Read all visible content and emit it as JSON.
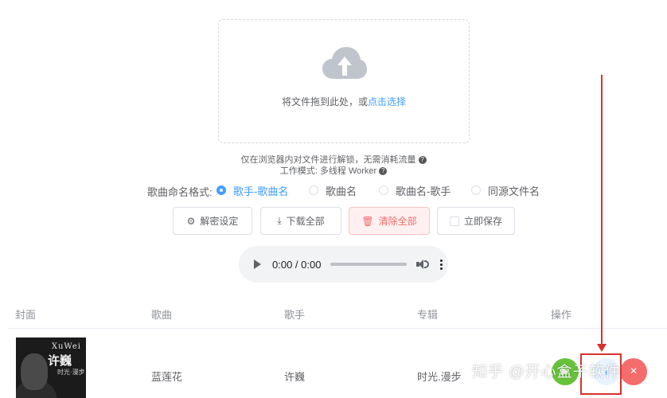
{
  "upload": {
    "hint_prefix": "将文件拖到此处，或",
    "hint_link": "点击选择",
    "icon": "cloud-upload-icon"
  },
  "info": {
    "line1": "仅在浏览器内对文件进行解锁，无需消耗流量",
    "line2": "工作模式: 多线程 Worker"
  },
  "naming": {
    "label": "歌曲命名格式:",
    "options": [
      "歌手-歌曲名",
      "歌曲名",
      "歌曲名-歌手",
      "同源文件名"
    ],
    "selected": "歌手-歌曲名"
  },
  "toolbar": {
    "decrypt_label": "解密设定",
    "download_all_label": "下载全部",
    "clear_all_label": "清除全部",
    "save_now_label": "立即保存"
  },
  "player": {
    "time": "0:00 / 0:00"
  },
  "table": {
    "headers": [
      "封面",
      "歌曲",
      "歌手",
      "专辑",
      "操作"
    ],
    "rows": [
      {
        "cover": {
          "brand": "XuWei",
          "name": "许巍",
          "sub": "时光·漫步"
        },
        "song": "蓝莲花",
        "artist": "许巍",
        "album": "时光.漫步"
      }
    ]
  },
  "watermark": "知乎 @开心盒子软件",
  "colors": {
    "primary": "#409eff",
    "danger": "#f56c6c",
    "success": "#67c23a",
    "annotation": "#d9312b"
  }
}
